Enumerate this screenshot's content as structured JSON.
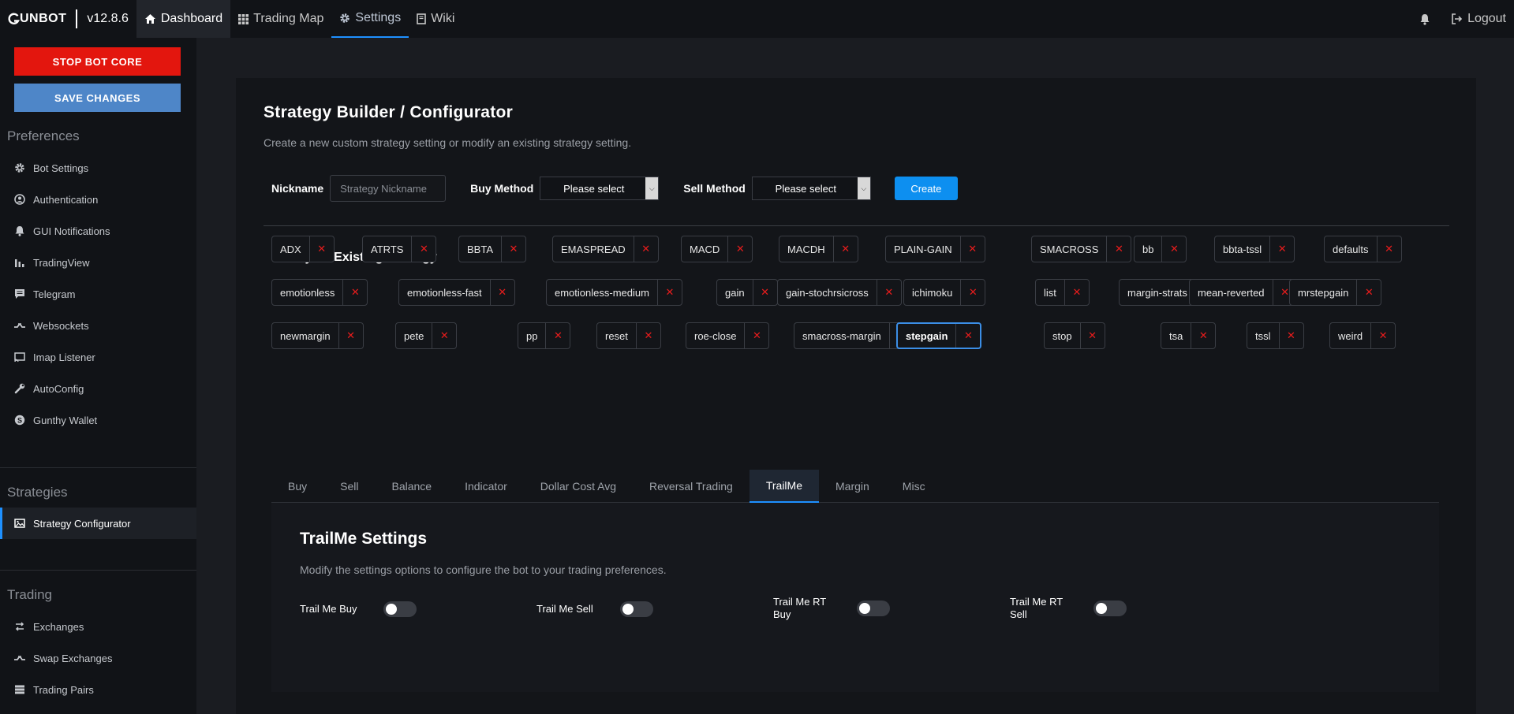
{
  "topbar": {
    "brand": "UNBOT",
    "version": "v12.8.6",
    "nav": [
      {
        "label": "Dashboard",
        "icon": "home-icon"
      },
      {
        "label": "Trading Map",
        "icon": "grid-icon"
      },
      {
        "label": "Settings",
        "icon": "gear-icon"
      },
      {
        "label": "Wiki",
        "icon": "book-icon"
      }
    ],
    "logout": "Logout"
  },
  "sidebar": {
    "stop_label": "STOP BOT CORE",
    "save_label": "SAVE CHANGES",
    "sections": {
      "preferences": "Preferences",
      "strategies": "Strategies",
      "trading": "Trading"
    },
    "preferences_items": [
      "Bot Settings",
      "Authentication",
      "GUI Notifications",
      "TradingView",
      "Telegram",
      "Websockets",
      "Imap Listener",
      "AutoConfig",
      "Gunthy Wallet"
    ],
    "strategies_items": [
      "Strategy Configurator"
    ],
    "trading_items": [
      "Exchanges",
      "Swap Exchanges",
      "Trading Pairs"
    ]
  },
  "builder": {
    "title": "Strategy Builder / Configurator",
    "subtitle": "Create a new custom strategy setting or modify an existing strategy setting.",
    "nickname_label": "Nickname",
    "nickname_placeholder": "Strategy Nickname",
    "buy_method_label": "Buy Method",
    "buy_method_value": "Please select",
    "sell_method_label": "Sell Method",
    "sell_method_value": "Please select",
    "create_label": "Create"
  },
  "modify": {
    "title": "Modify an Existing Strategy",
    "remove_symbol": "✕",
    "strategies": [
      "ADX",
      "ATRTS",
      "BBTA",
      "EMASPREAD",
      "MACD",
      "MACDH",
      "PLAIN-GAIN",
      "SMACROSS",
      "bb",
      "bbta-tssl",
      "defaults",
      "emotionless",
      "emotionless-fast",
      "emotionless-medium",
      "gain",
      "gain-stochrsicross",
      "ichimoku",
      "list",
      "margin-strats",
      "mean-reverted",
      "mrstepgain",
      "newmargin",
      "pete",
      "pp",
      "reset",
      "roe-close",
      "smacross-margin",
      "stepgain",
      "stop",
      "tsa",
      "tssl",
      "weird"
    ],
    "selected": "stepgain"
  },
  "tabs": [
    "Buy",
    "Sell",
    "Balance",
    "Indicator",
    "Dollar Cost Avg",
    "Reversal Trading",
    "TrailMe",
    "Margin",
    "Misc"
  ],
  "active_tab": "TrailMe",
  "trailme": {
    "title": "TrailMe Settings",
    "subtitle": "Modify the settings options to configure the bot to your trading preferences.",
    "toggles": [
      {
        "label": "Trail Me Buy",
        "on": false
      },
      {
        "label": "Trail Me Sell",
        "on": false
      },
      {
        "label": "Trail Me RT Buy",
        "on": false
      },
      {
        "label": "Trail Me RT Sell",
        "on": false
      }
    ]
  },
  "colors": {
    "accent": "#1e90ff",
    "stop": "#e3160e",
    "save": "#4e86c8",
    "remove": "#e81c1c"
  }
}
